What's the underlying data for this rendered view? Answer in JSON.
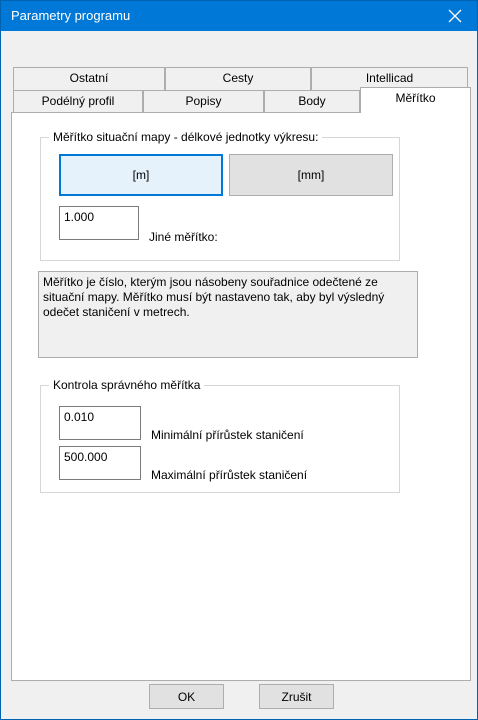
{
  "window": {
    "title": "Parametry programu",
    "accent_color": "#0078d7"
  },
  "tabs": {
    "row_back": [
      {
        "label": "Ostatní"
      },
      {
        "label": "Cesty"
      },
      {
        "label": "Intellicad"
      }
    ],
    "row_front": [
      {
        "label": "Podélný profil"
      },
      {
        "label": "Popisy"
      },
      {
        "label": "Body"
      },
      {
        "label": "Měřítko"
      }
    ],
    "active": "Měřítko"
  },
  "scale_group": {
    "legend": "Měřítko situační mapy - délkové jednotky výkresu:",
    "unit_m_label": "[m]",
    "unit_mm_label": "[mm]",
    "selected_unit": "[m]",
    "custom_scale_value": "1.000",
    "custom_scale_label": "Jiné měřítko:"
  },
  "note_text": "Měřítko je číslo, kterým jsou násobeny souřadnice odečtené ze situační mapy. Měřítko musí být nastaveno tak, aby byl výsledný odečet staničení v metrech.",
  "check_group": {
    "legend": "Kontrola správného měřítka",
    "min_value": "0.010",
    "min_label": "Minimální přírůstek staničení",
    "max_value": "500.000",
    "max_label": "Maximální přírůstek staničení"
  },
  "footer": {
    "ok_label": "OK",
    "cancel_label": "Zrušit"
  },
  "icons": {
    "close": "close-icon"
  }
}
